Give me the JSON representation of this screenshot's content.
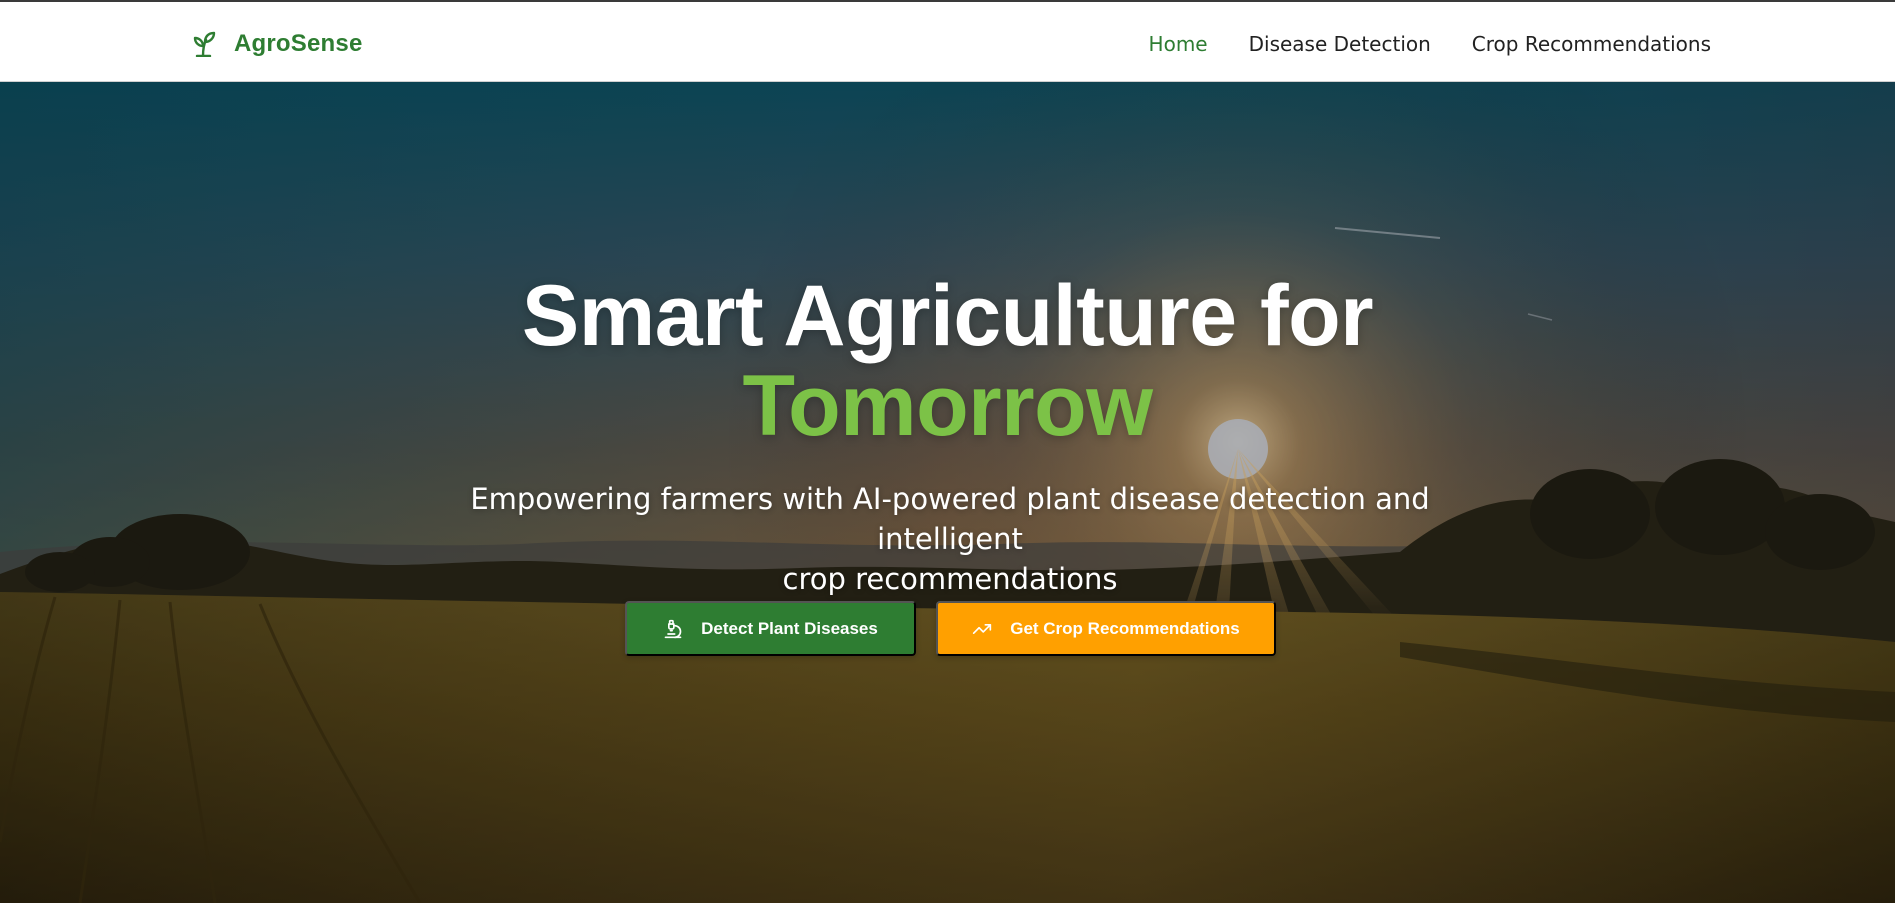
{
  "brand": {
    "name": "AgroSense",
    "icon": "seedling-icon",
    "color": "#2e7d32"
  },
  "nav": {
    "links": [
      {
        "label": "Home",
        "active": true
      },
      {
        "label": "Disease Detection",
        "active": false
      },
      {
        "label": "Crop Recommendations",
        "active": false
      }
    ]
  },
  "hero": {
    "headline_line1": "Smart Agriculture for",
    "headline_line2": "Tomorrow",
    "subtitle_line1": "Empowering farmers with AI-powered plant disease detection and intelligent",
    "subtitle_line2": "crop recommendations",
    "buttons": [
      {
        "label": "Detect Plant Diseases",
        "icon": "microscope-icon",
        "color": "#2e7d32"
      },
      {
        "label": "Get Crop Recommendations",
        "icon": "trending-up-icon",
        "color": "#ffa000"
      }
    ],
    "accent_color": "#7cc247"
  }
}
